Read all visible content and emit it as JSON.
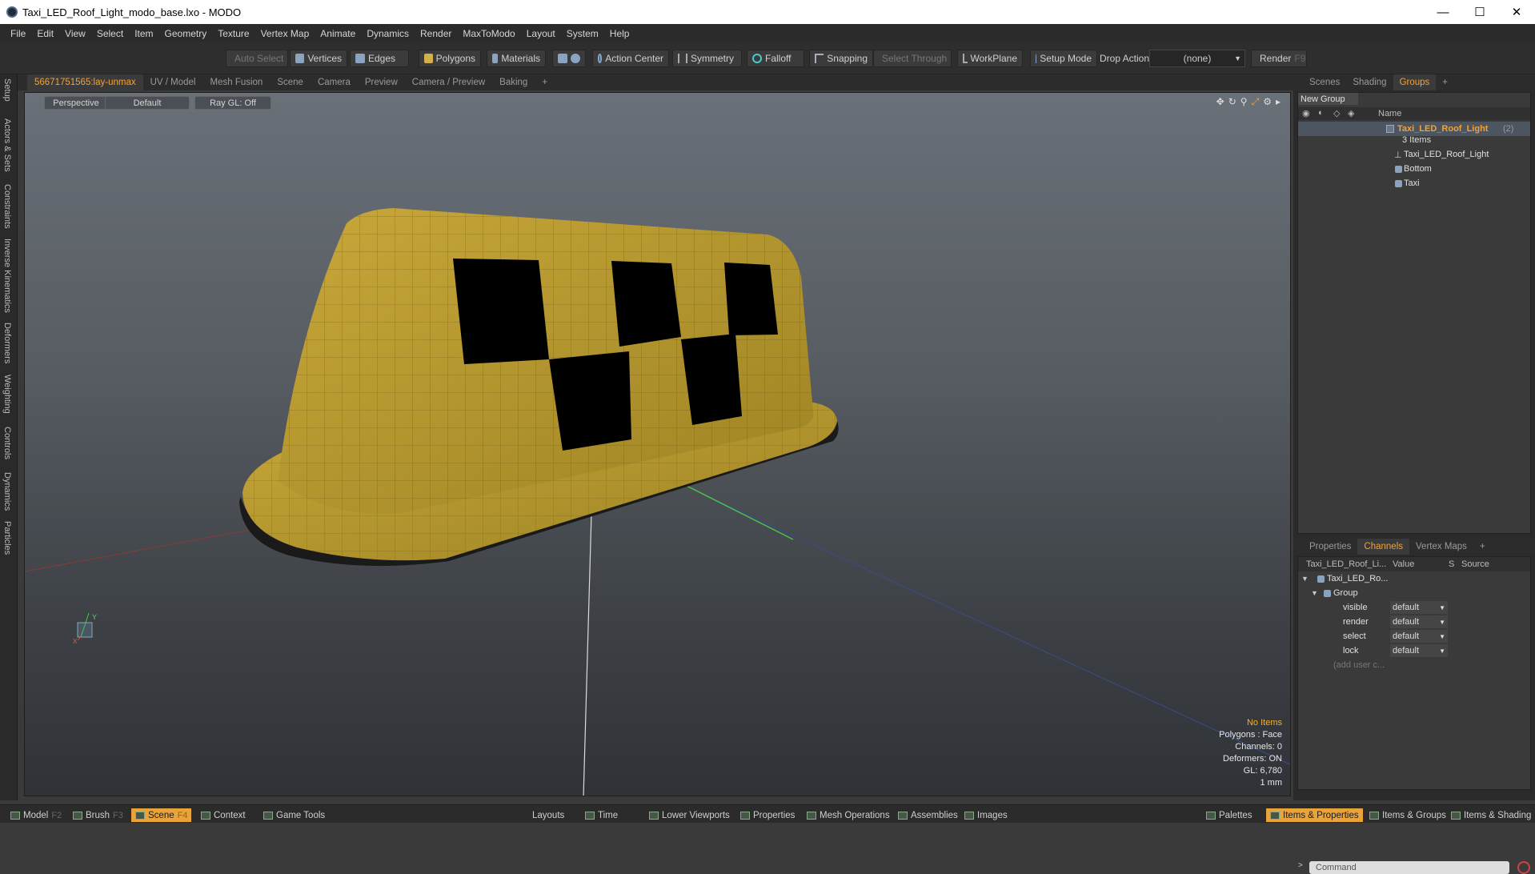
{
  "window": {
    "title": "Taxi_LED_Roof_Light_modo_base.lxo - MODO",
    "min": "—",
    "max": "☐",
    "close": "✕"
  },
  "menu": [
    "File",
    "Edit",
    "View",
    "Select",
    "Item",
    "Geometry",
    "Texture",
    "Vertex Map",
    "Animate",
    "Dynamics",
    "Render",
    "MaxToModo",
    "Layout",
    "System",
    "Help"
  ],
  "toolbar": {
    "auto_select": "Auto Select",
    "vertices": "Vertices",
    "edges": "Edges",
    "polygons": "Polygons",
    "materials": "Materials",
    "action_center": "Action Center",
    "symmetry": "Symmetry",
    "falloff": "Falloff",
    "snapping": "Snapping",
    "select_through": "Select Through",
    "workplane": "WorkPlane",
    "setup_mode": "Setup Mode",
    "drop_action_label": "Drop Action",
    "drop_action_value": "(none)",
    "render": "Render",
    "render_key": "F9"
  },
  "left_tabs": [
    "Setup",
    "Actors & Sets",
    "Constraints",
    "Inverse Kinematics",
    "Deformers",
    "Weighting",
    "Controls",
    "Dynamics",
    "Particles"
  ],
  "viewport_tabs": [
    "56671751565:lay-unmax",
    "UV / Model",
    "Mesh Fusion",
    "Scene",
    "Camera",
    "Preview",
    "Camera / Preview",
    "Baking",
    "+"
  ],
  "viewport": {
    "view": "Perspective",
    "shading": "Default",
    "raygl": "Ray GL: Off",
    "stats": {
      "items": "No Items",
      "polygons": "Polygons : Face",
      "channels": "Channels: 0",
      "deformers": "Deformers: ON",
      "gl": "GL: 6,780",
      "unit": "1 mm"
    },
    "axis_y": "Y",
    "axis_x": "X"
  },
  "right_top_tabs": [
    "Scenes",
    "Shading",
    "Groups",
    "+"
  ],
  "groups": {
    "new_group": "New Group",
    "col_name": "Name",
    "group_name": "Taxi_LED_Roof_Light",
    "group_count": "(2)",
    "items_count": "3 Items",
    "items": [
      "Taxi_LED_Roof_Light",
      "Bottom",
      "Taxi"
    ]
  },
  "right_bottom_tabs": [
    "Properties",
    "Channels",
    "Vertex Maps",
    "+"
  ],
  "channels": {
    "headers": [
      "Taxi_LED_Roof_Li...",
      "Value",
      "S",
      "Source"
    ],
    "root": "Taxi_LED_Ro...",
    "group": "Group",
    "rows": [
      {
        "name": "visible",
        "value": "default"
      },
      {
        "name": "render",
        "value": "default"
      },
      {
        "name": "select",
        "value": "default"
      },
      {
        "name": "lock",
        "value": "default"
      }
    ],
    "add_user": "(add user c..."
  },
  "command_placeholder": "Command",
  "bottom": {
    "model": "Model",
    "model_key": "F2",
    "brush": "Brush",
    "brush_key": "F3",
    "scene": "Scene",
    "scene_key": "F4",
    "context": "Context",
    "game_tools": "Game Tools",
    "layouts": "Layouts",
    "time": "Time",
    "lower_viewports": "Lower Viewports",
    "properties": "Properties",
    "mesh_operations": "Mesh Operations",
    "assemblies": "Assemblies",
    "images": "Images",
    "palettes": "Palettes",
    "items_properties": "Items & Properties",
    "items_groups": "Items & Groups",
    "items_shading": "Items & Shading"
  },
  "colors": {
    "accent": "#f2a23a",
    "taxi_yellow": "#b89a2c",
    "checker": "#000000"
  }
}
